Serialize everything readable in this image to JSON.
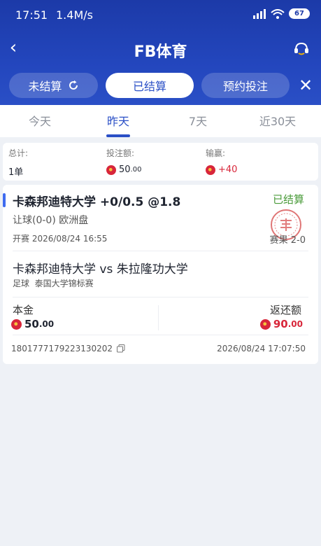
{
  "status_bar": {
    "time": "17:51",
    "speed": "1.4M/s",
    "battery": "67"
  },
  "header": {
    "title": "FB体育"
  },
  "filter_pills": [
    {
      "label": "未结算",
      "active": false
    },
    {
      "label": "已结算",
      "active": true
    },
    {
      "label": "预约投注",
      "active": false
    }
  ],
  "date_tabs": [
    {
      "label": "今天",
      "active": false
    },
    {
      "label": "昨天",
      "active": true
    },
    {
      "label": "7天",
      "active": false
    },
    {
      "label": "近30天",
      "active": false
    }
  ],
  "summary": {
    "total_label": "总计:",
    "total_value": "1单",
    "stake_label": "投注额:",
    "stake_value": "50",
    "stake_dec": ".00",
    "pnl_label": "输赢:",
    "pnl_value": "+40"
  },
  "bet": {
    "title": "卡森邦迪特大学 +0/0.5 @1.8",
    "status": "已结算",
    "market": "让球(0-0) 欧洲盘",
    "kickoff_label": "开赛",
    "kickoff_time": "2026/08/24 16:55",
    "result_label": "赛果",
    "result": "2-0",
    "match": "卡森邦迪特大学 vs 朱拉隆功大学",
    "sport": "足球",
    "league": "泰国大学锦标赛",
    "stake_label": "本金",
    "stake_int": "50",
    "stake_dec": ".00",
    "return_label": "返还额",
    "return_int": "90",
    "return_dec": ".00",
    "order_id": "1801777179223130202",
    "settle_time": "2026/08/24 17:07:50"
  },
  "colors": {
    "brand": "#2a4fc6",
    "win": "#d8263a",
    "settled": "#4a9b3a"
  }
}
